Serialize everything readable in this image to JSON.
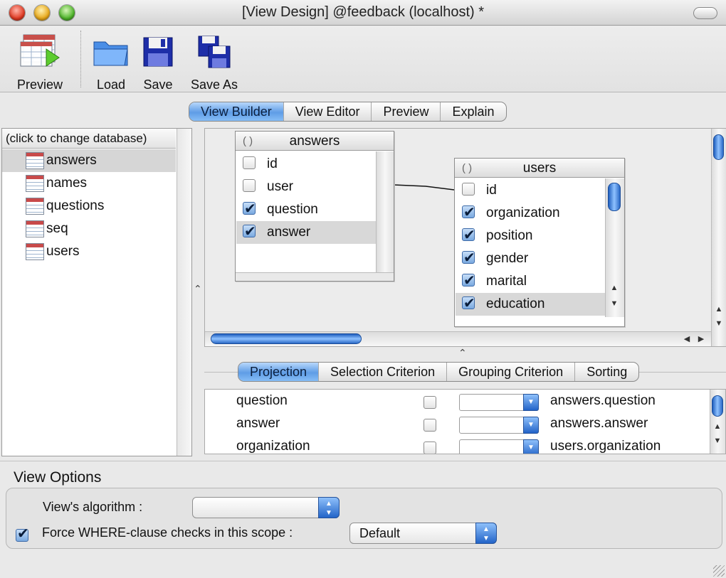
{
  "window": {
    "title": "[View Design]  @feedback (localhost) *"
  },
  "toolbar": {
    "preview": "Preview",
    "load": "Load",
    "save": "Save",
    "save_as": "Save As"
  },
  "main_tabs": [
    "View Builder",
    "View Editor",
    "Preview",
    "Explain"
  ],
  "main_tab_active": "View Builder",
  "database": {
    "header": "(click to change database)",
    "items": [
      "answers",
      "names",
      "questions",
      "seq",
      "users"
    ],
    "selected": "answers"
  },
  "tables": {
    "answers": {
      "title": "answers",
      "fields": [
        {
          "name": "id",
          "checked": false
        },
        {
          "name": "user",
          "checked": false
        },
        {
          "name": "question",
          "checked": true
        },
        {
          "name": "answer",
          "checked": true
        }
      ],
      "selected": "answer"
    },
    "users": {
      "title": "users",
      "fields": [
        {
          "name": "id",
          "checked": false
        },
        {
          "name": "organization",
          "checked": true
        },
        {
          "name": "position",
          "checked": true
        },
        {
          "name": "gender",
          "checked": true
        },
        {
          "name": "marital",
          "checked": true
        },
        {
          "name": "education",
          "checked": true
        }
      ],
      "selected": "education"
    }
  },
  "criteria_tabs": [
    "Projection",
    "Selection Criterion",
    "Grouping Criterion",
    "Sorting"
  ],
  "criteria_tab_active": "Projection",
  "projection": [
    {
      "name": "question",
      "expr": "answers.question"
    },
    {
      "name": "answer",
      "expr": "answers.answer"
    },
    {
      "name": "organization",
      "expr": "users.organization"
    }
  ],
  "view_options": {
    "title": "View Options",
    "algorithm_label": "View's algorithm :",
    "algorithm_value": "",
    "force_label": "Force WHERE-clause checks in this scope :",
    "force_checked": true,
    "force_value": "Default"
  }
}
